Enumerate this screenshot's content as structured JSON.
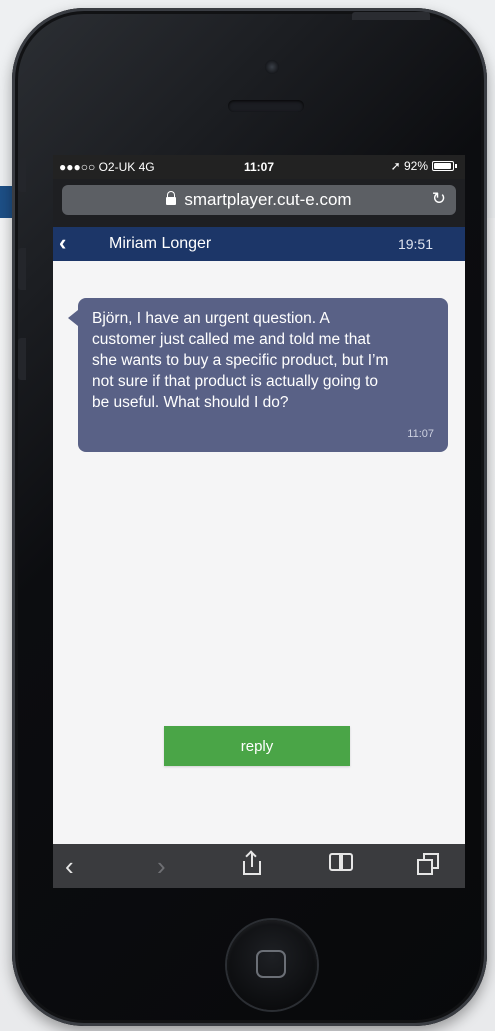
{
  "status_bar": {
    "carrier": "●●●○○ O2-UK  4G",
    "time": "11:07",
    "battery_text": "➚ 92%",
    "battery_level": 0.92
  },
  "browser": {
    "url": "smartplayer.cut-e.com",
    "reload_icon": "reload-icon"
  },
  "chat_header": {
    "back_icon": "‹",
    "contact_name": "Miriam Longer",
    "time": "19:51"
  },
  "message": {
    "text": "Björn, I have an urgent question. A customer just called me and told me that she wants to buy a specific product, but I’m not sure if that product is actually going to be useful. What should I do?",
    "time": "11:07",
    "bubble_color": "#596186"
  },
  "reply_button": {
    "label": "reply",
    "color": "#4aa547"
  },
  "toolbar": {
    "back": "‹",
    "forward": "›"
  }
}
